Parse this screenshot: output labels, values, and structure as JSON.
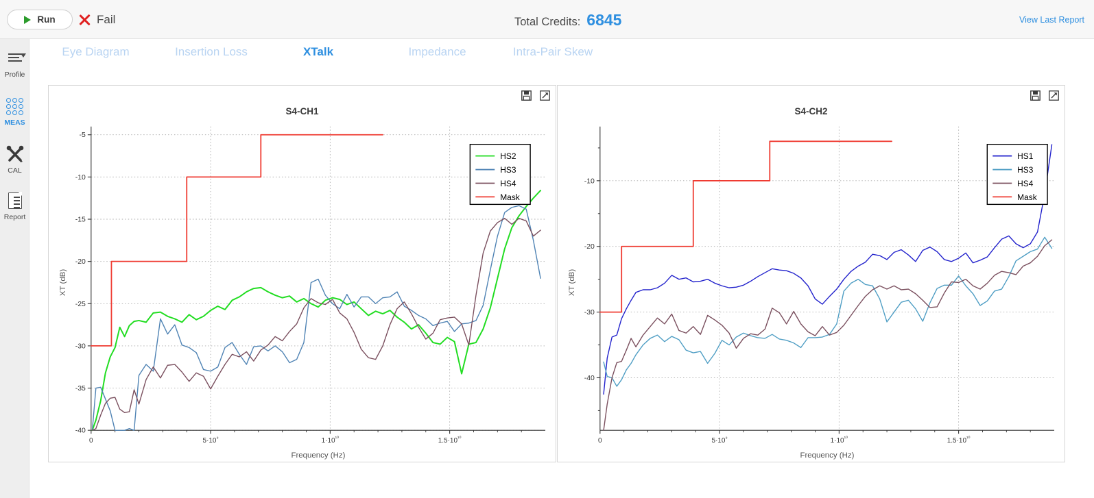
{
  "topbar": {
    "run_label": "Run",
    "status_label": "Fail",
    "credits_label": "Total Credits:",
    "credits_value": "6845",
    "view_last_report": "View Last Report",
    "accent_color": "#2e8fe0",
    "fail_color": "#e02020",
    "run_play_color": "#2c9c2c"
  },
  "sidebar": {
    "items": [
      {
        "label": "Profile",
        "icon": "profile-menu-icon",
        "active": false
      },
      {
        "label": "MEAS",
        "icon": "measurement-grid-icon",
        "active": true
      },
      {
        "label": "CAL",
        "icon": "calibration-tools-icon",
        "active": false
      },
      {
        "label": "Report",
        "icon": "report-document-icon",
        "active": false
      }
    ]
  },
  "tabs": [
    {
      "label": "Eye Diagram",
      "active": false
    },
    {
      "label": "Insertion Loss",
      "active": false
    },
    {
      "label": "XTalk",
      "active": true
    },
    {
      "label": "Impedance",
      "active": false
    },
    {
      "label": "Intra-Pair Skew",
      "active": false
    }
  ],
  "panel_tools": {
    "save_icon": "save-floppy-icon",
    "expand_icon": "expand-maximize-icon"
  },
  "chart_data": [
    {
      "id": "s4-ch1",
      "type": "line",
      "title": "S4-CH1",
      "xlabel": "Frequency (Hz)",
      "ylabel": "XT (dB)",
      "xlim": [
        0,
        19000000000
      ],
      "ylim": [
        -40,
        -5
      ],
      "xticks": [
        0,
        5000000000,
        10000000000,
        15000000000
      ],
      "xticklabels": [
        "0",
        "5·10⁹",
        "1·10¹⁰",
        "1.5·10¹⁰"
      ],
      "yticks": [
        -5,
        -10,
        -15,
        -20,
        -25,
        -30,
        -35,
        -40
      ],
      "yticklabels": [
        "-5",
        "-10",
        "-15",
        "-20",
        "-25",
        "-30",
        "-35",
        "-40"
      ],
      "grid": true,
      "legend_position": "top-right",
      "series": [
        {
          "name": "HS2",
          "color": "#22dd22",
          "x": [
            0.05,
            0.2,
            0.4,
            0.6,
            0.8,
            1.0,
            1.2,
            1.4,
            1.6,
            1.8,
            2.0,
            2.3,
            2.6,
            2.9,
            3.2,
            3.5,
            3.8,
            4.1,
            4.4,
            4.7,
            5.0,
            5.3,
            5.6,
            5.9,
            6.2,
            6.5,
            6.8,
            7.1,
            7.4,
            7.7,
            8.0,
            8.3,
            8.6,
            8.9,
            9.2,
            9.5,
            9.8,
            10.1,
            10.4,
            10.7,
            11.0,
            11.3,
            11.6,
            11.9,
            12.2,
            12.5,
            12.8,
            13.1,
            13.4,
            13.7,
            14.0,
            14.3,
            14.6,
            14.9,
            15.2,
            15.5,
            15.8,
            16.1,
            16.4,
            16.7,
            17.0,
            17.3,
            17.6,
            17.9,
            18.2,
            18.5,
            18.8
          ],
          "y": [
            -40,
            -38.8,
            -36.5,
            -33.2,
            -31.3,
            -30.2,
            -27.8,
            -28.9,
            -27.6,
            -27.1,
            -27.0,
            -27.2,
            -26.1,
            -26.0,
            -26.5,
            -26.8,
            -27.2,
            -26.3,
            -26.9,
            -26.5,
            -25.8,
            -25.3,
            -25.7,
            -24.6,
            -24.2,
            -23.6,
            -23.2,
            -23.1,
            -23.6,
            -24.0,
            -24.3,
            -24.1,
            -24.8,
            -24.4,
            -25.0,
            -25.4,
            -24.6,
            -24.3,
            -24.5,
            -25.1,
            -24.8,
            -25.6,
            -26.4,
            -25.9,
            -26.2,
            -25.8,
            -26.6,
            -27.2,
            -28.0,
            -27.5,
            -28.5,
            -29.6,
            -29.8,
            -29.0,
            -29.5,
            -33.3,
            -29.8,
            -29.6,
            -28.0,
            -25.5,
            -22.0,
            -18.5,
            -16.0,
            -14.6,
            -13.5,
            -12.5,
            -11.6
          ]
        },
        {
          "name": "HS3",
          "color": "#4f83b4",
          "x": [
            0.05,
            0.2,
            0.4,
            0.6,
            0.8,
            1.0,
            1.2,
            1.4,
            1.6,
            1.8,
            2.0,
            2.3,
            2.6,
            2.9,
            3.2,
            3.5,
            3.8,
            4.1,
            4.4,
            4.7,
            5.0,
            5.3,
            5.6,
            5.9,
            6.2,
            6.5,
            6.8,
            7.1,
            7.4,
            7.7,
            8.0,
            8.3,
            8.6,
            8.9,
            9.2,
            9.5,
            9.8,
            10.1,
            10.4,
            10.7,
            11.0,
            11.3,
            11.6,
            11.9,
            12.2,
            12.5,
            12.8,
            13.1,
            13.4,
            13.7,
            14.0,
            14.3,
            14.6,
            14.9,
            15.2,
            15.5,
            15.8,
            16.1,
            16.4,
            16.7,
            17.0,
            17.3,
            17.6,
            17.9,
            18.2,
            18.5,
            18.8
          ],
          "y": [
            -40,
            -35.0,
            -34.9,
            -36.3,
            -37.7,
            -40,
            -40,
            -40,
            -39.8,
            -40,
            -33.5,
            -32.2,
            -33.0,
            -26.8,
            -28.6,
            -27.5,
            -29.9,
            -30.2,
            -30.8,
            -32.8,
            -33.0,
            -32.5,
            -30.2,
            -29.6,
            -31.0,
            -32.2,
            -30.1,
            -30.0,
            -30.6,
            -30.0,
            -30.7,
            -32.0,
            -31.6,
            -29.6,
            -22.5,
            -22.1,
            -24.0,
            -25.0,
            -25.6,
            -23.9,
            -25.4,
            -24.2,
            -24.2,
            -25.0,
            -24.3,
            -24.2,
            -23.6,
            -25.3,
            -25.8,
            -26.4,
            -26.8,
            -27.6,
            -27.3,
            -27.1,
            -28.3,
            -27.4,
            -27.3,
            -27.0,
            -25.2,
            -21.0,
            -17.0,
            -14.2,
            -13.6,
            -13.4,
            -13.8,
            -17.5,
            -22.0
          ]
        },
        {
          "name": "HS4",
          "color": "#7a4f5e",
          "x": [
            0.05,
            0.2,
            0.4,
            0.6,
            0.8,
            1.0,
            1.2,
            1.4,
            1.6,
            1.8,
            2.0,
            2.3,
            2.6,
            2.9,
            3.2,
            3.5,
            3.8,
            4.1,
            4.4,
            4.7,
            5.0,
            5.3,
            5.6,
            5.9,
            6.2,
            6.5,
            6.8,
            7.1,
            7.4,
            7.7,
            8.0,
            8.3,
            8.6,
            8.9,
            9.2,
            9.5,
            9.8,
            10.1,
            10.4,
            10.7,
            11.0,
            11.3,
            11.6,
            11.9,
            12.2,
            12.5,
            12.8,
            13.1,
            13.4,
            13.7,
            14.0,
            14.3,
            14.6,
            14.9,
            15.2,
            15.5,
            15.8,
            16.1,
            16.4,
            16.7,
            17.0,
            17.3,
            17.6,
            17.9,
            18.2,
            18.5,
            18.8
          ],
          "y": [
            -40,
            -39.8,
            -38.2,
            -36.8,
            -36.2,
            -36.1,
            -37.5,
            -37.9,
            -37.8,
            -35.2,
            -36.9,
            -34.0,
            -32.5,
            -33.8,
            -32.3,
            -32.2,
            -33.1,
            -34.2,
            -33.2,
            -33.6,
            -35.1,
            -33.6,
            -32.2,
            -31.0,
            -31.3,
            -30.7,
            -31.8,
            -30.5,
            -29.9,
            -28.9,
            -29.4,
            -28.3,
            -27.4,
            -25.5,
            -24.4,
            -24.9,
            -25.1,
            -24.5,
            -26.1,
            -26.8,
            -28.4,
            -30.4,
            -31.4,
            -31.6,
            -30.0,
            -27.5,
            -25.6,
            -24.8,
            -26.2,
            -27.8,
            -29.2,
            -28.5,
            -26.9,
            -26.7,
            -26.6,
            -27.4,
            -29.9,
            -24.0,
            -19.0,
            -16.4,
            -15.4,
            -14.9,
            -15.6,
            -14.9,
            -15.2,
            -17.0,
            -16.3
          ]
        },
        {
          "name": "Mask",
          "color": "#ef3b32",
          "type": "step",
          "x": [
            0,
            0.85,
            0.85,
            4.0,
            4.0,
            7.1,
            7.1,
            12.2
          ],
          "y": [
            -30,
            -30,
            -20,
            -20,
            -10,
            -10,
            -5,
            -5
          ]
        }
      ]
    },
    {
      "id": "s4-ch2",
      "type": "line",
      "title": "S4-CH2",
      "xlabel": "Frequency (Hz)",
      "ylabel": "XT (dB)",
      "xlim": [
        0,
        19000000000
      ],
      "ylim": [
        -48,
        -3
      ],
      "xticks": [
        0,
        5000000000,
        10000000000,
        15000000000
      ],
      "xticklabels": [
        "0",
        "5·10⁹",
        "1·10¹⁰",
        "1.5·10¹⁰"
      ],
      "yticks": [
        -10,
        -20,
        -30,
        -40
      ],
      "yticklabels": [
        "-10",
        "-20",
        "-30",
        "-40"
      ],
      "grid": true,
      "legend_position": "top-right",
      "series": [
        {
          "name": "HS1",
          "color": "#2222cc",
          "x": [
            0.15,
            0.3,
            0.5,
            0.7,
            0.9,
            1.1,
            1.3,
            1.5,
            1.8,
            2.1,
            2.4,
            2.7,
            3.0,
            3.3,
            3.6,
            3.9,
            4.2,
            4.5,
            4.8,
            5.1,
            5.4,
            5.7,
            6.0,
            6.3,
            6.6,
            6.9,
            7.2,
            7.5,
            7.8,
            8.1,
            8.4,
            8.7,
            9.0,
            9.3,
            9.6,
            9.9,
            10.2,
            10.5,
            10.8,
            11.1,
            11.4,
            11.7,
            12.0,
            12.3,
            12.6,
            12.9,
            13.2,
            13.5,
            13.8,
            14.1,
            14.4,
            14.7,
            15.0,
            15.3,
            15.6,
            15.9,
            16.2,
            16.5,
            16.8,
            17.1,
            17.4,
            17.7,
            18.0,
            18.3,
            18.6,
            18.9
          ],
          "y": [
            -42.5,
            -37.0,
            -33.8,
            -33.5,
            -31.0,
            -29.5,
            -28.2,
            -27.0,
            -26.6,
            -26.6,
            -26.3,
            -25.6,
            -24.4,
            -25.0,
            -24.8,
            -25.4,
            -25.3,
            -25.0,
            -25.6,
            -26.0,
            -26.3,
            -26.2,
            -25.9,
            -25.3,
            -24.6,
            -24.0,
            -23.4,
            -23.6,
            -23.7,
            -24.1,
            -24.8,
            -26.0,
            -28.0,
            -28.8,
            -27.6,
            -26.5,
            -25.0,
            -23.8,
            -23.0,
            -22.4,
            -21.2,
            -21.4,
            -22.0,
            -20.9,
            -20.5,
            -21.3,
            -22.3,
            -20.6,
            -20.1,
            -20.8,
            -22.0,
            -22.3,
            -21.8,
            -21.0,
            -22.5,
            -22.1,
            -21.6,
            -20.2,
            -18.9,
            -18.4,
            -19.6,
            -20.2,
            -19.6,
            -17.8,
            -12.0,
            -4.5
          ]
        },
        {
          "name": "HS3",
          "color": "#4f9ec4",
          "x": [
            0.15,
            0.3,
            0.5,
            0.7,
            0.9,
            1.1,
            1.3,
            1.5,
            1.8,
            2.1,
            2.4,
            2.7,
            3.0,
            3.3,
            3.6,
            3.9,
            4.2,
            4.5,
            4.8,
            5.1,
            5.4,
            5.7,
            6.0,
            6.3,
            6.6,
            6.9,
            7.2,
            7.5,
            7.8,
            8.1,
            8.4,
            8.7,
            9.0,
            9.3,
            9.6,
            9.9,
            10.2,
            10.5,
            10.8,
            11.1,
            11.4,
            11.7,
            12.0,
            12.3,
            12.6,
            12.9,
            13.2,
            13.5,
            13.8,
            14.1,
            14.4,
            14.7,
            15.0,
            15.3,
            15.6,
            15.9,
            16.2,
            16.5,
            16.8,
            17.1,
            17.4,
            17.7,
            18.0,
            18.3,
            18.6,
            18.9
          ],
          "y": [
            -37.6,
            -39.8,
            -40.0,
            -41.3,
            -40.3,
            -38.8,
            -37.8,
            -36.5,
            -35.0,
            -34.0,
            -33.5,
            -34.5,
            -33.7,
            -34.2,
            -35.8,
            -36.2,
            -36.0,
            -37.8,
            -36.3,
            -34.3,
            -35.0,
            -33.8,
            -33.2,
            -33.6,
            -33.9,
            -34.0,
            -33.4,
            -34.1,
            -34.3,
            -34.7,
            -35.4,
            -33.9,
            -33.9,
            -33.8,
            -33.4,
            -31.8,
            -26.8,
            -25.6,
            -25.0,
            -25.8,
            -26.0,
            -28.0,
            -31.5,
            -30.0,
            -28.5,
            -28.2,
            -29.5,
            -31.4,
            -28.6,
            -26.4,
            -25.9,
            -25.9,
            -24.5,
            -26.0,
            -27.2,
            -29.0,
            -28.3,
            -26.8,
            -26.5,
            -24.6,
            -22.2,
            -21.5,
            -20.8,
            -20.4,
            -18.6,
            -20.3
          ]
        },
        {
          "name": "HS4",
          "color": "#7a4f5e",
          "x": [
            0.15,
            0.3,
            0.5,
            0.7,
            0.9,
            1.1,
            1.3,
            1.5,
            1.8,
            2.1,
            2.4,
            2.7,
            3.0,
            3.3,
            3.6,
            3.9,
            4.2,
            4.5,
            4.8,
            5.1,
            5.4,
            5.7,
            6.0,
            6.3,
            6.6,
            6.9,
            7.2,
            7.5,
            7.8,
            8.1,
            8.4,
            8.7,
            9.0,
            9.3,
            9.6,
            9.9,
            10.2,
            10.5,
            10.8,
            11.1,
            11.4,
            11.7,
            12.0,
            12.3,
            12.6,
            12.9,
            13.2,
            13.5,
            13.8,
            14.1,
            14.4,
            14.7,
            15.0,
            15.3,
            15.6,
            15.9,
            16.2,
            16.5,
            16.8,
            17.1,
            17.4,
            17.7,
            18.0,
            18.3,
            18.6,
            18.9
          ],
          "y": [
            -48.0,
            -44.0,
            -40.0,
            -37.7,
            -37.5,
            -35.8,
            -34.0,
            -35.3,
            -33.5,
            -32.2,
            -30.9,
            -31.8,
            -30.3,
            -32.8,
            -33.2,
            -32.2,
            -33.4,
            -30.5,
            -31.2,
            -32.0,
            -33.2,
            -35.5,
            -34.0,
            -33.3,
            -33.5,
            -32.6,
            -29.4,
            -30.1,
            -31.8,
            -29.9,
            -31.8,
            -33.0,
            -33.6,
            -32.2,
            -33.5,
            -33.1,
            -32.0,
            -30.5,
            -29.0,
            -27.6,
            -26.6,
            -26.0,
            -26.5,
            -26.0,
            -26.6,
            -26.5,
            -27.2,
            -28.2,
            -29.3,
            -29.2,
            -27.1,
            -25.4,
            -25.5,
            -25.0,
            -26.0,
            -26.5,
            -25.6,
            -24.4,
            -23.8,
            -24.0,
            -24.3,
            -23.0,
            -22.5,
            -21.5,
            -19.9,
            -19.0
          ]
        },
        {
          "name": "Mask",
          "color": "#ef3b32",
          "type": "step",
          "x": [
            0,
            0.9,
            0.9,
            3.9,
            3.9,
            7.1,
            7.1,
            12.2
          ],
          "y": [
            -30,
            -30,
            -20,
            -20,
            -10,
            -10,
            -4,
            -4
          ]
        }
      ]
    }
  ]
}
